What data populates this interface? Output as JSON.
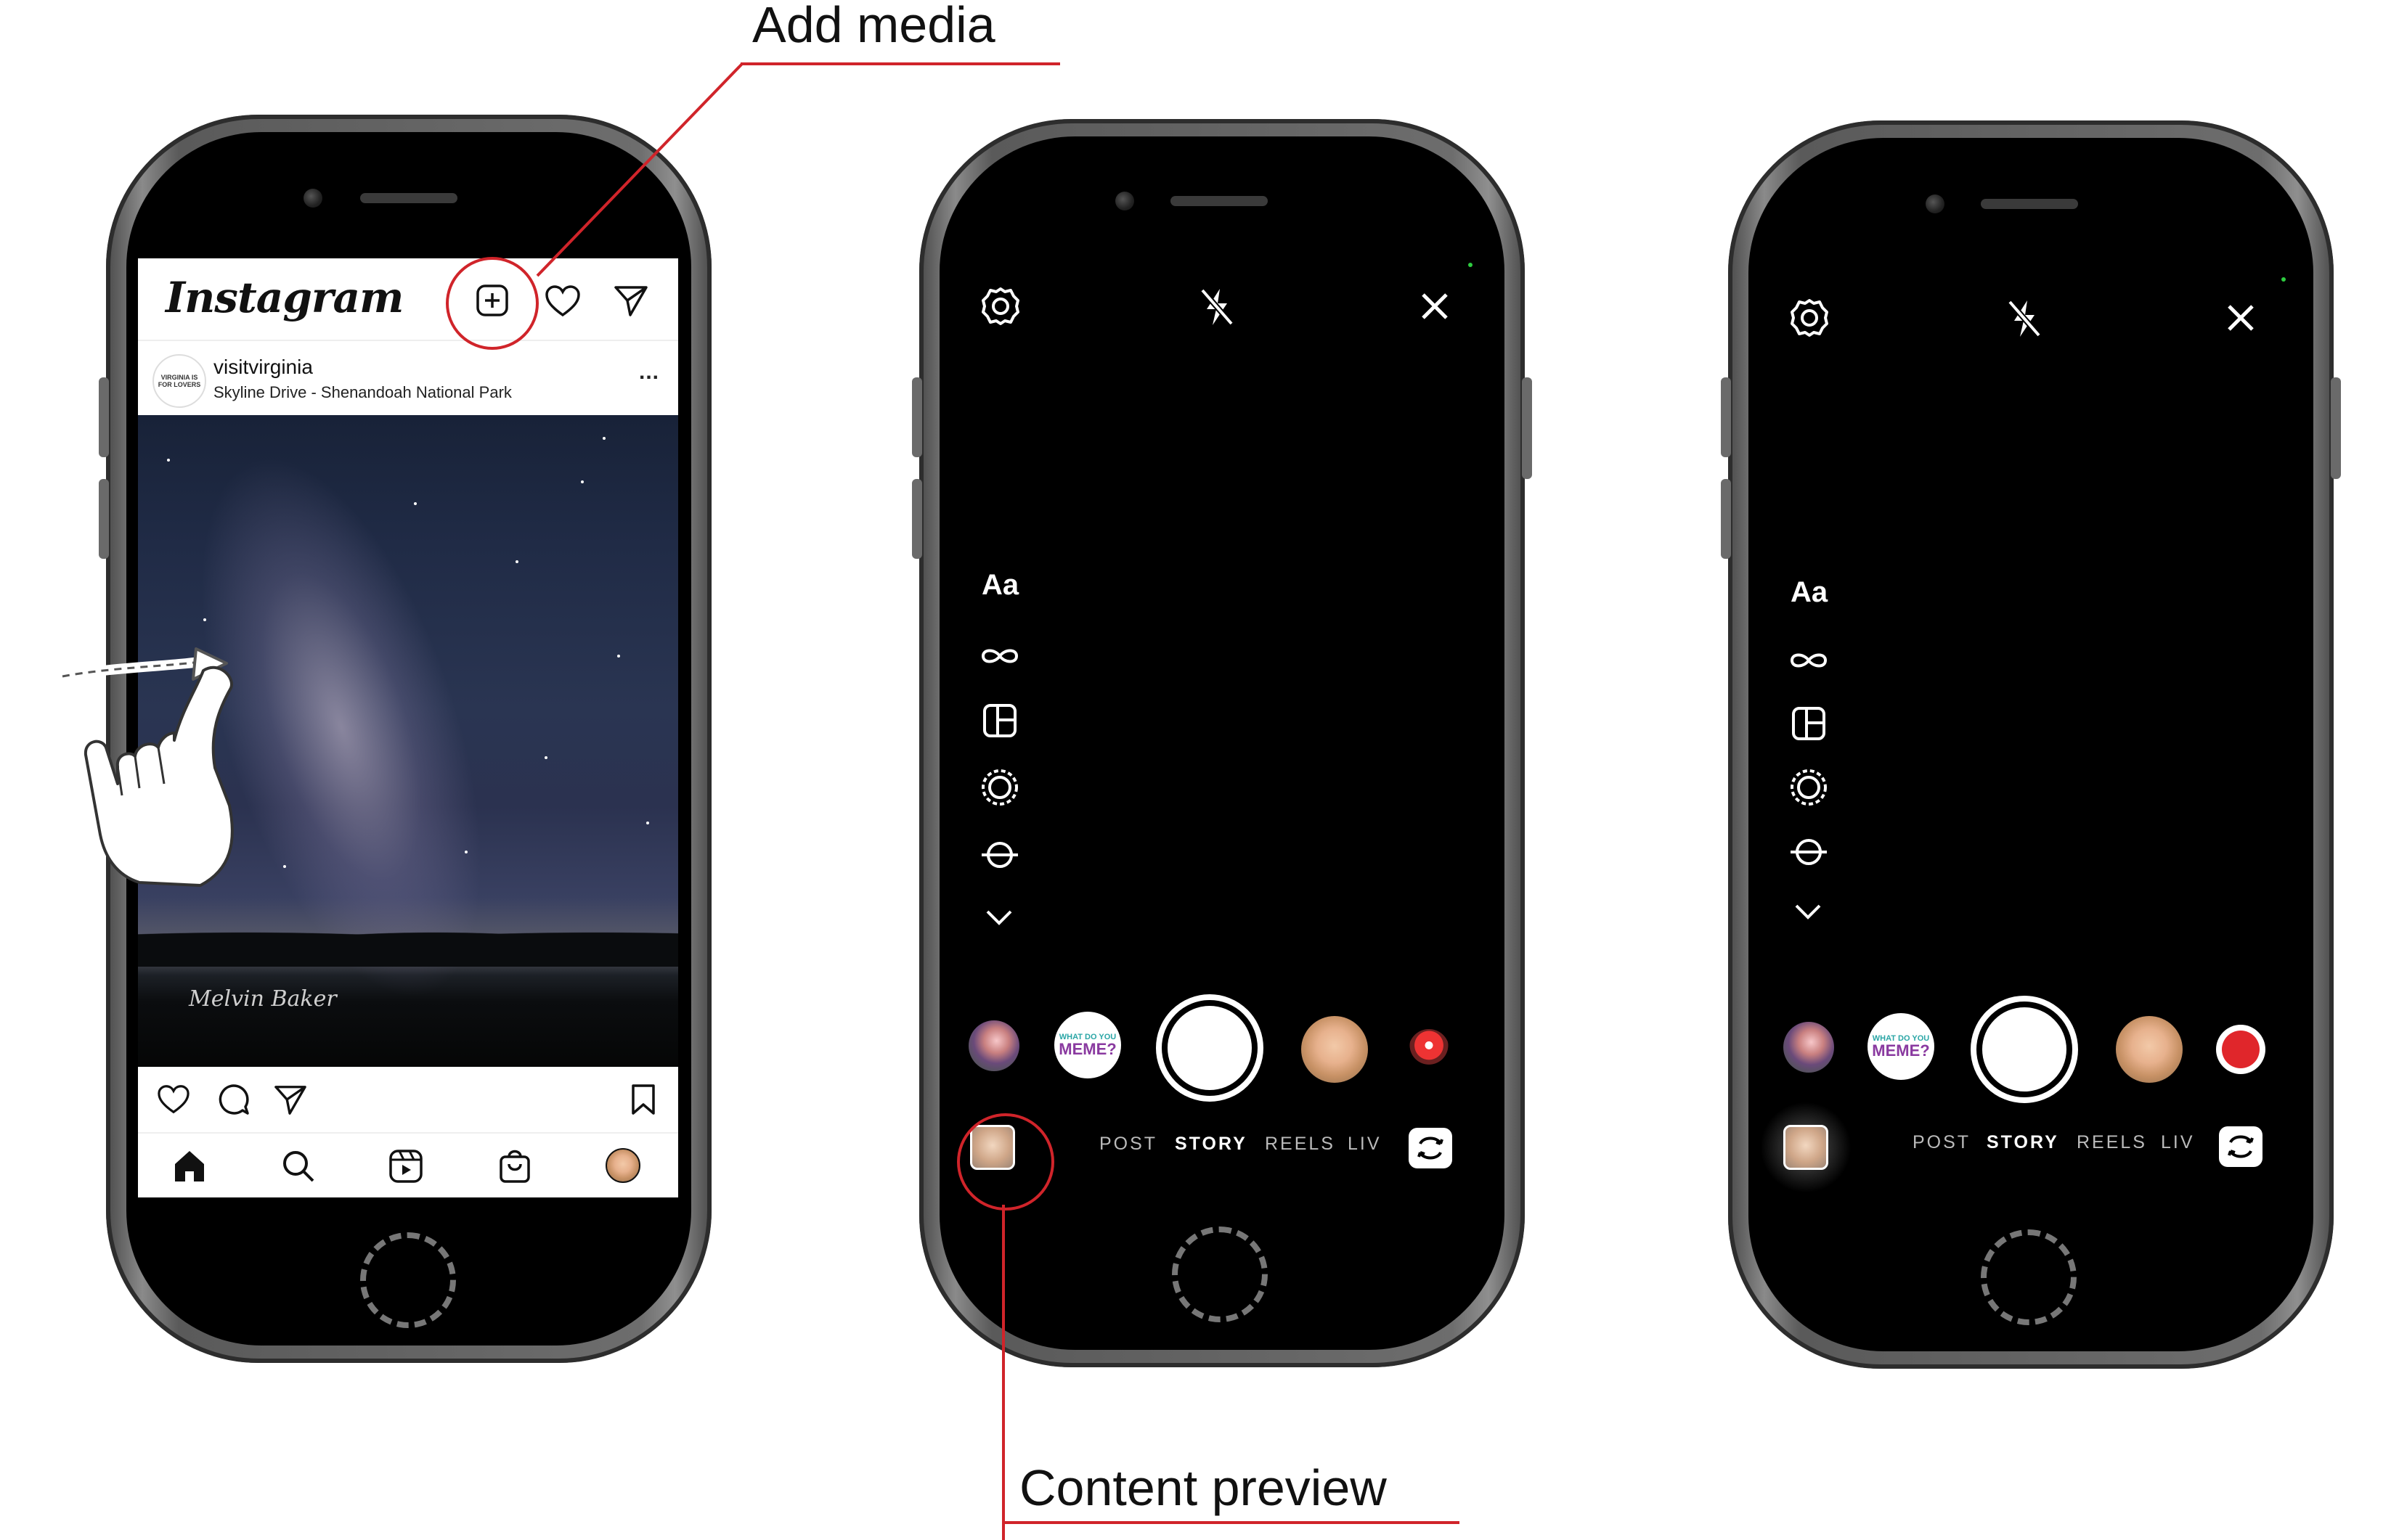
{
  "annotations": {
    "add_media": "Add media",
    "content_preview": "Content preview",
    "accent_color": "#d0242a"
  },
  "phone1": {
    "app_logo": "Instagram",
    "header_icons": [
      "add-media-icon",
      "heart-icon",
      "send-icon"
    ],
    "post": {
      "username": "visitvirginia",
      "location": "Skyline Drive - Shenandoah National Park",
      "avatar_text": "VIRGINIA IS FOR LOVERS",
      "more": "...",
      "photo_signature": "Melvin Baker"
    },
    "action_icons": [
      "heart-icon",
      "comment-icon",
      "send-icon",
      "bookmark-icon"
    ],
    "nav_icons": [
      "home-icon",
      "search-icon",
      "reels-icon",
      "shop-icon",
      "profile-avatar"
    ],
    "gesture": "swipe-right-hand-icon"
  },
  "camera": {
    "top_icons": [
      "settings-gear-icon",
      "flash-off-icon",
      "close-icon"
    ],
    "side_text_tool": "Aa",
    "side_icons": [
      "boomerang-icon",
      "layout-icon",
      "hands-free-icon",
      "level-icon",
      "chevron-down-icon"
    ],
    "effects": {
      "meme_top": "WHAT DO YOU",
      "meme_main": "MEME?"
    },
    "modes": [
      "POST",
      "STORY",
      "REELS",
      "LIVE"
    ],
    "active_mode": "STORY",
    "flip_icon": "flip-camera-icon",
    "record_color": "#e0262b"
  }
}
